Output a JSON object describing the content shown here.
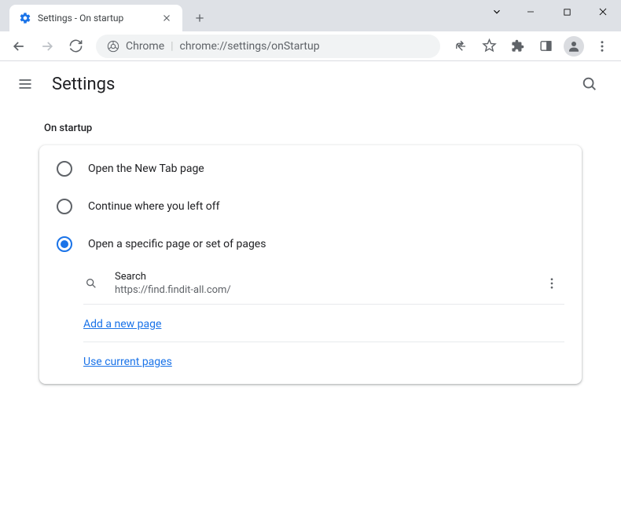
{
  "window": {
    "tab_title": "Settings - On startup"
  },
  "omnibox": {
    "scheme_label": "Chrome",
    "url": "chrome://settings/onStartup"
  },
  "page": {
    "title": "Settings"
  },
  "section": {
    "heading": "On startup",
    "options": [
      {
        "label": "Open the New Tab page",
        "checked": false
      },
      {
        "label": "Continue where you left off",
        "checked": false
      },
      {
        "label": "Open a specific page or set of pages",
        "checked": true
      }
    ],
    "startup_page": {
      "name": "Search",
      "url": "https://find.findit-all.com/"
    },
    "add_page_label": "Add a new page",
    "use_current_label": "Use current pages"
  }
}
